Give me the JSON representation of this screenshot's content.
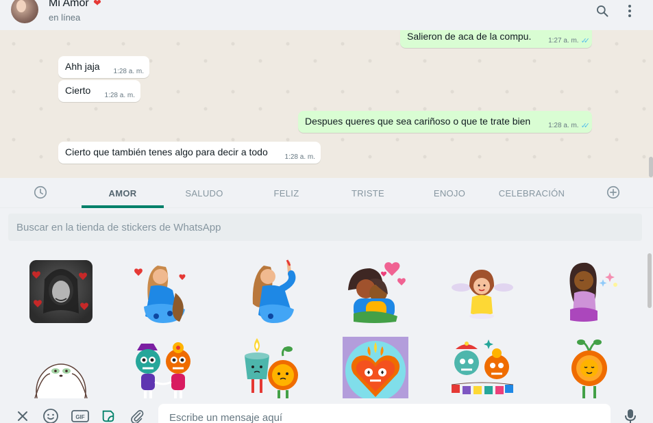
{
  "header": {
    "contact_name": "Mi Amor",
    "contact_emoji": "❤",
    "status": "en línea",
    "icons": [
      "search-icon",
      "menu-icon"
    ]
  },
  "messages": [
    {
      "direction": "out",
      "text": "Salieron de aca de la compu.",
      "time": "1:27 a. m.",
      "read": true
    },
    {
      "direction": "in",
      "text": "Ahh jaja",
      "time": "1:28 a. m."
    },
    {
      "direction": "in",
      "text": "Cierto",
      "time": "1:28 a. m."
    },
    {
      "direction": "out",
      "text": "Despues queres que sea cariñoso o que te trate bien",
      "time": "1:28 a. m.",
      "read": true
    },
    {
      "direction": "in",
      "text": "Cierto que también tenes algo para decir a todo",
      "time": "1:28 a. m."
    }
  ],
  "sticker_tabs": {
    "recent_icon": "clock-icon",
    "add_icon": "add-icon",
    "items": [
      "AMOR",
      "SALUDO",
      "FELIZ",
      "TRISTE",
      "ENOJO",
      "CELEBRACIÓN"
    ],
    "active": "AMOR"
  },
  "sticker_search": {
    "placeholder": "Buscar en la tienda de stickers de WhatsApp"
  },
  "stickers": [
    "photo-girl-hearts-sticker",
    "woman-blowing-kiss-sticker",
    "woman-pointing-sticker",
    "couple-hug-hearts-sticker",
    "girl-clouds-sticker",
    "woman-sparkles-sticker",
    "sloth-sticker",
    "skull-couple-sticker",
    "candle-flower-sticker",
    "heart-skull-sticker",
    "skull-pair-flags-sticker",
    "flower-character-sticker"
  ],
  "footer": {
    "input_placeholder": "Escribe un mensaje aquí",
    "icons": [
      "close-icon",
      "emoji-icon",
      "gif-icon",
      "sticker-icon",
      "attach-icon",
      "mic-icon"
    ],
    "gif_label": "GIF"
  },
  "colors": {
    "accent": "#008069",
    "outgoing_bubble": "#d9fdd3",
    "incoming_bubble": "#ffffff",
    "chat_bg": "#efeae2",
    "read_ticks": "#53bdeb"
  }
}
